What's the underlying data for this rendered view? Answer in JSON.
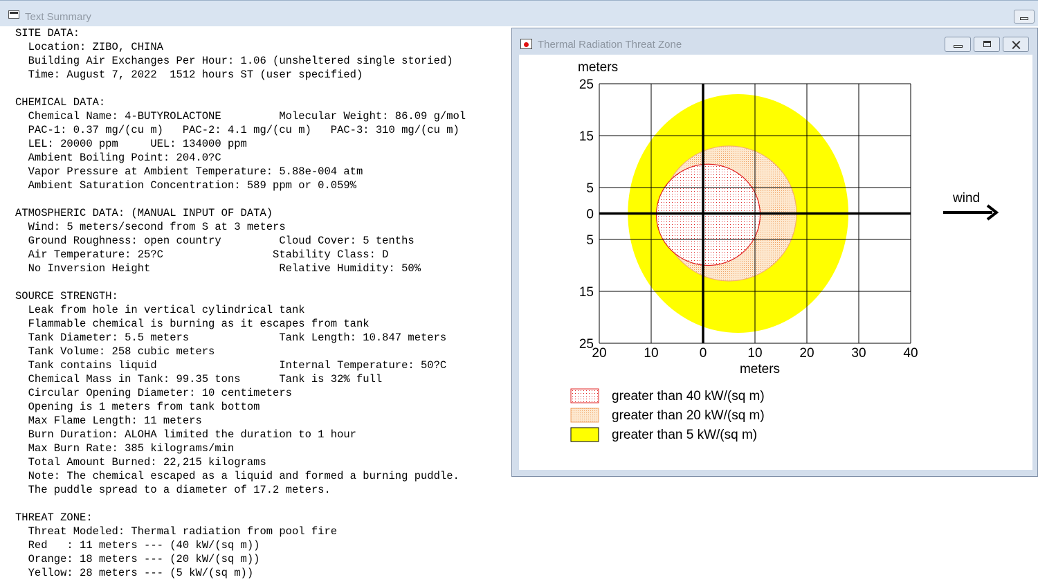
{
  "main_window": {
    "title": "Text Summary"
  },
  "summary_lines": [
    "SITE DATA:",
    "  Location: ZIBO, CHINA",
    "  Building Air Exchanges Per Hour: 1.06 (unsheltered single storied)",
    "  Time: August 7, 2022  1512 hours ST (user specified)",
    "",
    "CHEMICAL DATA:",
    "  Chemical Name: 4-BUTYROLACTONE         Molecular Weight: 86.09 g/mol",
    "  PAC-1: 0.37 mg/(cu m)   PAC-2: 4.1 mg/(cu m)   PAC-3: 310 mg/(cu m)",
    "  LEL: 20000 ppm     UEL: 134000 ppm",
    "  Ambient Boiling Point: 204.0?C",
    "  Vapor Pressure at Ambient Temperature: 5.88e-004 atm",
    "  Ambient Saturation Concentration: 589 ppm or 0.059%",
    "",
    "ATMOSPHERIC DATA: (MANUAL INPUT OF DATA)",
    "  Wind: 5 meters/second from S at 3 meters",
    "  Ground Roughness: open country         Cloud Cover: 5 tenths",
    "  Air Temperature: 25?C                 Stability Class: D",
    "  No Inversion Height                    Relative Humidity: 50%",
    "",
    "SOURCE STRENGTH:",
    "  Leak from hole in vertical cylindrical tank",
    "  Flammable chemical is burning as it escapes from tank",
    "  Tank Diameter: 5.5 meters              Tank Length: 10.847 meters",
    "  Tank Volume: 258 cubic meters",
    "  Tank contains liquid                   Internal Temperature: 50?C",
    "  Chemical Mass in Tank: 99.35 tons      Tank is 32% full",
    "  Circular Opening Diameter: 10 centimeters",
    "  Opening is 1 meters from tank bottom",
    "  Max Flame Length: 11 meters",
    "  Burn Duration: ALOHA limited the duration to 1 hour",
    "  Max Burn Rate: 385 kilograms/min",
    "  Total Amount Burned: 22,215 kilograms",
    "  Note: The chemical escaped as a liquid and formed a burning puddle.",
    "  The puddle spread to a diameter of 17.2 meters.",
    "",
    "THREAT ZONE:",
    "  Threat Modeled: Thermal radiation from pool fire",
    "  Red   : 11 meters --- (40 kW/(sq m))",
    "  Orange: 18 meters --- (20 kW/(sq m))",
    "  Yellow: 28 meters --- (5 kW/(sq m))"
  ],
  "threat_window": {
    "title": "Thermal Radiation Threat Zone",
    "buttons": {
      "minimize": "minimize",
      "maximize": "maximize",
      "close": "close"
    }
  },
  "chart_data": {
    "type": "threat-zone-contours",
    "x_axis": {
      "label": "meters",
      "range": [
        -20,
        40
      ],
      "ticks": [
        20,
        10,
        0,
        10,
        20,
        30,
        40
      ],
      "tick_values": [
        -20,
        -10,
        0,
        10,
        20,
        30,
        40
      ]
    },
    "y_axis": {
      "label": "meters",
      "range": [
        -25,
        25
      ],
      "ticks": [
        25,
        15,
        5,
        0,
        5,
        15,
        25
      ],
      "tick_values": [
        25,
        15,
        5,
        0,
        -5,
        -15,
        -25
      ]
    },
    "grid": true,
    "wind_label": "wind",
    "wind_direction": "east",
    "zones": [
      {
        "name": "greater than 40 kW/(sq m)",
        "color": "#e02020",
        "fill": "dotted-red",
        "x_min": -9,
        "x_max": 11,
        "y_min": -10,
        "y_max": 9.5
      },
      {
        "name": "greater than 20 kW/(sq m)",
        "color": "#f4b070",
        "fill": "dotted-orange",
        "x_min": -8,
        "x_max": 18,
        "y_min": -13,
        "y_max": 13
      },
      {
        "name": "greater than 5 kW/(sq m)",
        "color": "#ffff00",
        "fill": "solid-yellow",
        "x_min": -14.5,
        "x_max": 28,
        "y_min": -23,
        "y_max": 23
      }
    ],
    "legend": [
      {
        "label": "greater than 40 kW/(sq m)",
        "fill": "dotted-red"
      },
      {
        "label": "greater than 20 kW/(sq m)",
        "fill": "dotted-orange"
      },
      {
        "label": "greater than 5 kW/(sq m)",
        "fill": "solid-yellow"
      }
    ],
    "legend_placement": "bottom-left"
  }
}
